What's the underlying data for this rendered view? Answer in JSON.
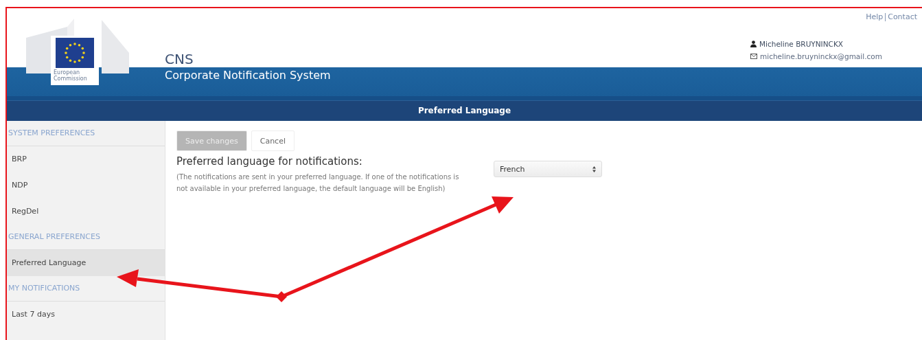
{
  "logo": {
    "caption": "European Commission"
  },
  "header": {
    "title": "CNS",
    "subtitle": "Corporate Notification System",
    "links": [
      "Help",
      "Contact"
    ],
    "user_name": "Micheline BRUYNINCKX",
    "user_email": "micheline.bruyninckx@gmail.com"
  },
  "page_title": "Preferred Language",
  "sidebar": {
    "sections": [
      {
        "heading": "SYSTEM PREFERENCES",
        "items": [
          {
            "label": "BRP",
            "selected": false
          },
          {
            "label": "NDP",
            "selected": false
          },
          {
            "label": "RegDel",
            "selected": false
          }
        ]
      },
      {
        "heading": "GENERAL PREFERENCES",
        "items": [
          {
            "label": "Preferred Language",
            "selected": true
          }
        ]
      },
      {
        "heading": "MY NOTIFICATIONS",
        "items": [
          {
            "label": "Last 7 days",
            "selected": false
          }
        ]
      }
    ]
  },
  "buttons": [
    {
      "label": "Save changes",
      "kind": "primary",
      "disabled": true
    },
    {
      "label": "Cancel",
      "kind": "secondary",
      "disabled": false
    }
  ],
  "setting": {
    "label": "Preferred language for notifications:",
    "help": "(The notifications are sent in your preferred language. If one of the notifications is not available in your preferred language, the default language will be English)",
    "value": "French"
  }
}
